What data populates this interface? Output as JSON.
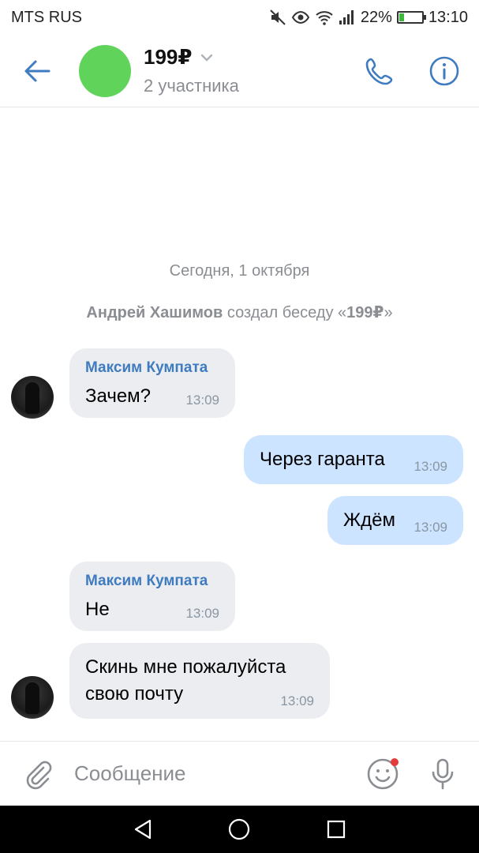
{
  "status_bar": {
    "carrier": "MTS RUS",
    "battery_percent_text": "22%",
    "battery_level": 0.22,
    "time": "13:10",
    "icons": [
      "mute-icon",
      "eye-icon",
      "wifi-icon",
      "signal-icon",
      "battery-charging-icon"
    ]
  },
  "header": {
    "title": "199₽",
    "subtitle": "2 участника",
    "avatar_color": "#5fd35a",
    "icons": [
      "back-arrow-icon",
      "chevron-down-icon",
      "phone-icon",
      "info-icon"
    ]
  },
  "chat": {
    "date_separator": "Сегодня, 1 октября",
    "service": {
      "author": "Андрей Хашимов",
      "action": "создал беседу «",
      "chat_name": "199₽",
      "suffix": "»"
    },
    "messages": [
      {
        "direction": "in",
        "sender": "Максим Кумпата",
        "text": "Зачем?",
        "time": "13:09"
      },
      {
        "direction": "out",
        "text": "Через гаранта",
        "time": "13:09"
      },
      {
        "direction": "out",
        "text": "Ждём",
        "time": "13:09"
      },
      {
        "direction": "in",
        "sender": "Максим Кумпата",
        "text": "Не",
        "time": "13:09"
      },
      {
        "direction": "in",
        "text": "Скинь мне пожалуйста\nсвою почту",
        "time": "13:09"
      }
    ]
  },
  "composer": {
    "placeholder": "Сообщение",
    "icons": [
      "paperclip-icon",
      "emoji-icon",
      "microphone-icon"
    ]
  },
  "colors": {
    "accent": "#3f7bbf",
    "incoming_bubble": "#ebedf0",
    "outgoing_bubble": "#cce4ff",
    "notification_dot": "#e53a3a"
  }
}
